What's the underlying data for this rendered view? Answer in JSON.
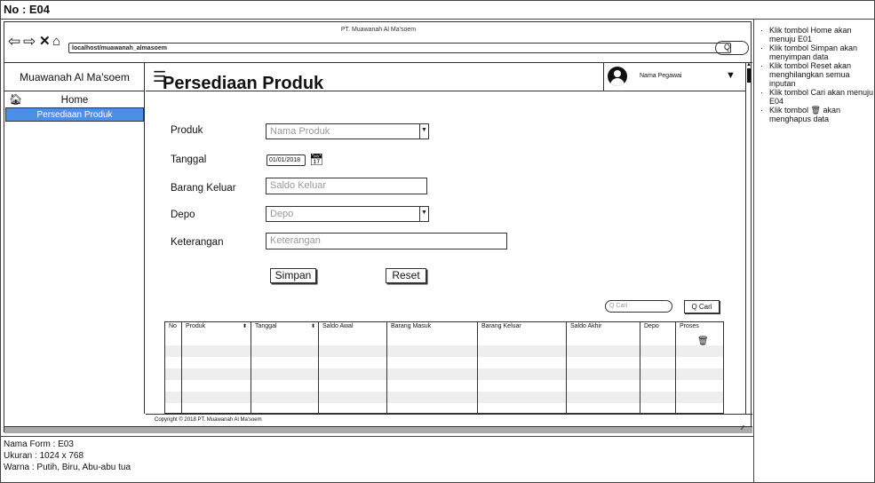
{
  "screen_id": "No : E04",
  "browser": {
    "title": "PT. Muawanah Al Ma'soem",
    "url": "localhost/muawanah_almasoem",
    "search_icon": "Q"
  },
  "sidebar": {
    "brand": "Muawanah Al Ma'soem",
    "items": [
      {
        "label": "Home",
        "icon": "home-icon",
        "active": false
      },
      {
        "label": "Persediaan Produk",
        "active": true
      }
    ],
    "active_color": "#4c8fe6"
  },
  "header": {
    "user_name": "Nama Pegawai"
  },
  "form": {
    "title": "Persediaan Produk",
    "produk": {
      "label": "Produk",
      "placeholder": "Nama Produk"
    },
    "tanggal": {
      "label": "Tanggal",
      "value": "01/01/2018"
    },
    "barang_keluar": {
      "label": "Barang Keluar",
      "placeholder": "Saldo Keluar"
    },
    "depo": {
      "label": "Depo",
      "placeholder": "Depo"
    },
    "keterangan": {
      "label": "Keterangan",
      "placeholder": "Keterangan"
    },
    "save_label": "Simpan",
    "reset_label": "Reset"
  },
  "search": {
    "placeholder": "Q Cari",
    "button_label": "Q Cari"
  },
  "table": {
    "columns": [
      {
        "label": "No"
      },
      {
        "label": "Produk"
      },
      {
        "label": "Tanggal"
      },
      {
        "label": "Saldo Awal"
      },
      {
        "label": "Barang Masuk"
      },
      {
        "label": "Barang Keluar"
      },
      {
        "label": "Saldo Akhir"
      },
      {
        "label": "Depo"
      },
      {
        "label": "Proses"
      }
    ]
  },
  "footer": {
    "copyright": "Copyright © 2018 PT. Muawanah Al Ma'soem"
  },
  "info": {
    "form_name": "Nama Form : E03",
    "size": "Ukuran : 1024 x 768",
    "colors": "Warna : Putih, Biru, Abu-abu tua"
  },
  "notes": [
    "Klik tombol Home akan menuju E01",
    "Klik tombol Simpan akan menyimpan data",
    "Klik tombol Reset akan menghilangkan semua inputan",
    "Klik tombol Cari akan menuju E04",
    "Klik tombol [trash] akan menghapus data"
  ]
}
